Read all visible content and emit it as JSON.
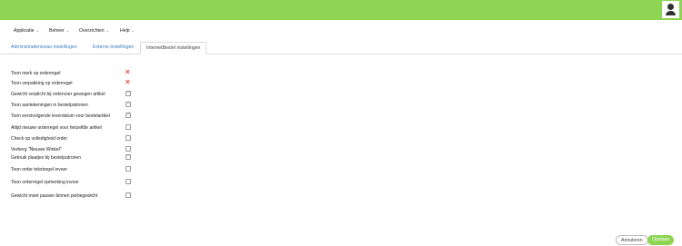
{
  "menu": {
    "items": [
      {
        "label": "Applicatie",
        "chevron": "chevron-down-icon"
      },
      {
        "label": "Beheer",
        "chevron": "chevron-down-icon"
      },
      {
        "label": "Overzichten",
        "chevron": "chevron-down-icon"
      },
      {
        "label": "Help",
        "chevron": "chevron-down-icon"
      }
    ]
  },
  "tabs": [
    {
      "label": "Administratieniveau instellingen",
      "active": false
    },
    {
      "label": "Externe instellingen",
      "active": false
    },
    {
      "label": "InternetBestel instellingen",
      "active": true
    }
  ],
  "settings": [
    {
      "label": "Toon merk op orderregel",
      "state": "cross"
    },
    {
      "label": "Toon verpakking op orderregel",
      "state": "cross"
    },
    {
      "label": "Gewicht verplicht bij ordervoer gewogen artikel",
      "state": "checked"
    },
    {
      "label": "Toon aantekeningen in bestelpatronen",
      "state": "checked"
    },
    {
      "label": "Toon eerstvolgende leverdatum voor bestelartikel",
      "state": "checked"
    },
    {
      "label": "Altijd nieuwe orderregel voor hetzelfde artikel",
      "state": "unchecked"
    },
    {
      "label": "Check op volledigheid order",
      "state": "unchecked"
    },
    {
      "label": "Verberg \"Nieuwe Winkel\"",
      "state": "unchecked"
    },
    {
      "label": "Gebruik plaatjes bij bestelpatronen",
      "state": "checked"
    },
    {
      "label": "Toon order tekstregel invoer",
      "state": "unchecked"
    },
    {
      "label": "Toon orderregel opmerking invoer",
      "state": "unchecked"
    },
    {
      "label": "Gewicht moet passen binnen portiegewicht",
      "state": "unchecked"
    }
  ],
  "footer": {
    "cancel_label": "Annuleren",
    "save_label": "Opslaan"
  },
  "colors": {
    "brand_green": "#8ed554",
    "cross_red": "#e02020",
    "tab_link": "#3a7fc4"
  },
  "icons": {
    "user": "user-icon",
    "cross": "cross-icon",
    "check": "checkmark-icon"
  }
}
